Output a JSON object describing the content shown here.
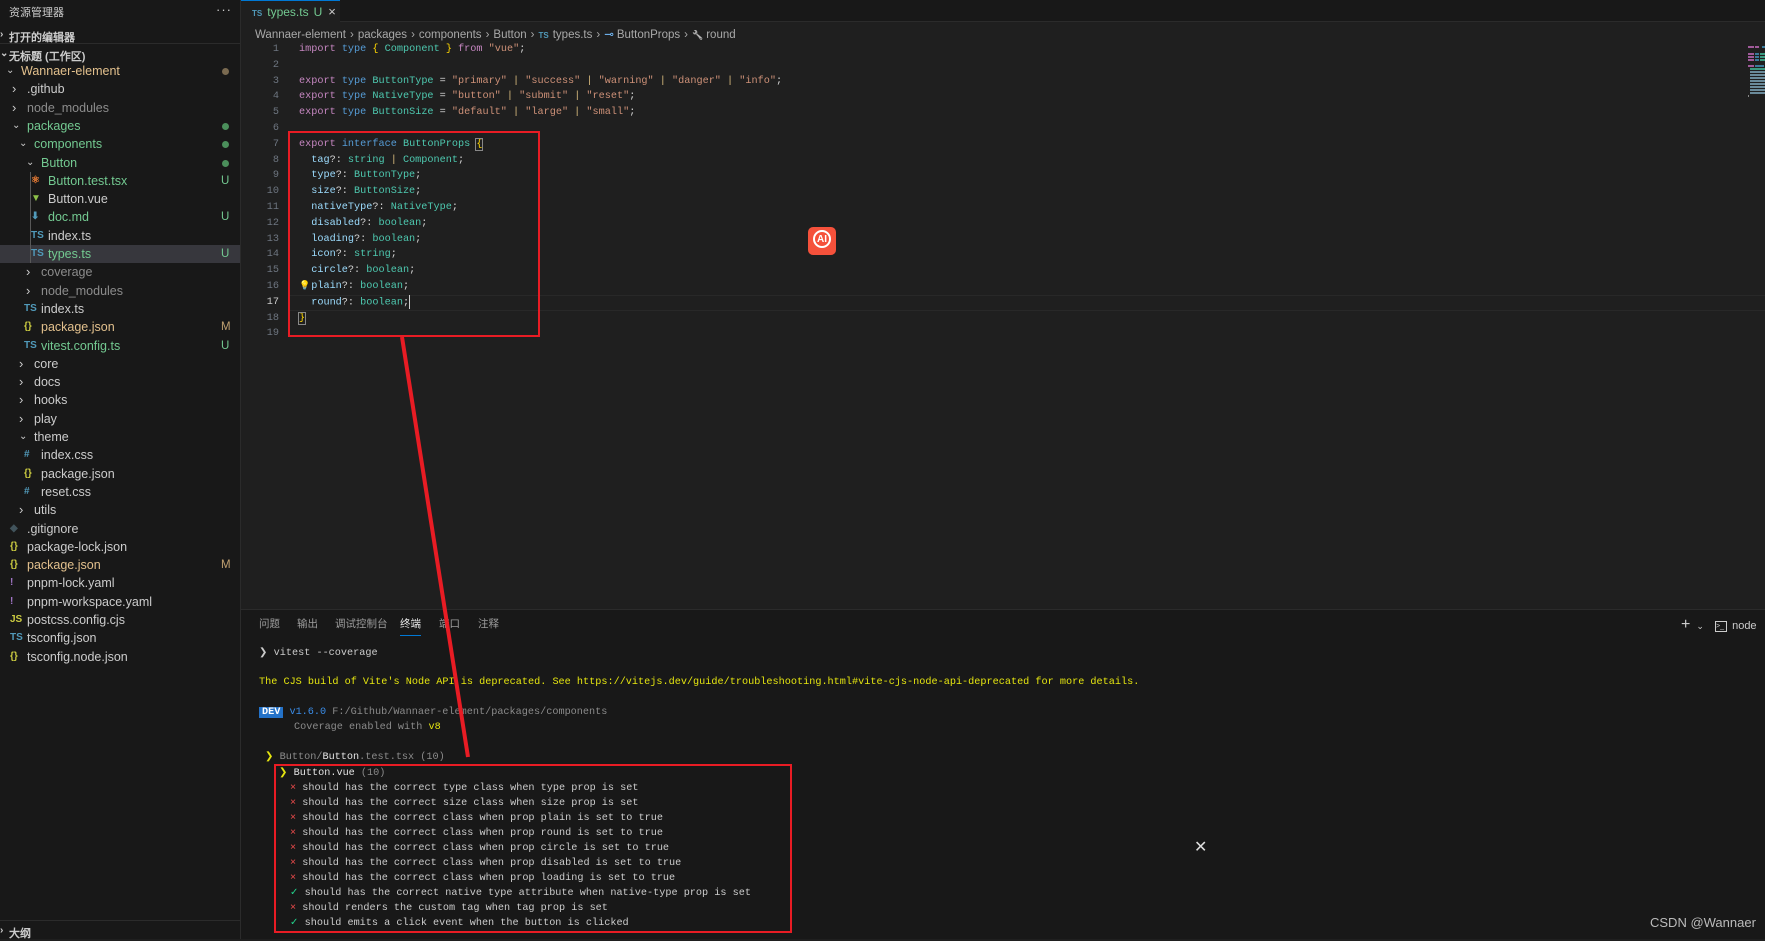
{
  "sidebar": {
    "title": "资源管理器",
    "more": "···",
    "open_editors": "打开的编辑器",
    "workspace": "无标题 (工作区)",
    "outline": "大纲",
    "items": [
      {
        "label": "Wannaer-element",
        "depth": 0,
        "kind": "open",
        "color": "#e2c08d",
        "dot": "#7a6a50"
      },
      {
        "label": ".github",
        "depth": 1,
        "kind": "closed",
        "color": "#cccccc"
      },
      {
        "label": "node_modules",
        "depth": 1,
        "kind": "closed",
        "color": "#8c8c8c"
      },
      {
        "label": "packages",
        "depth": 1,
        "kind": "open",
        "color": "#73c991",
        "dot": "#4b8f5b"
      },
      {
        "label": "components",
        "depth": 2,
        "kind": "open",
        "color": "#73c991",
        "dot": "#4b8f5b"
      },
      {
        "label": "Button",
        "depth": 3,
        "kind": "open",
        "color": "#73c991",
        "dot": "#4b8f5b"
      },
      {
        "label": "Button.test.tsx",
        "depth": 4,
        "kind": "file",
        "icon": "⚛",
        "icon_name": "react-icon",
        "icon_color": "#e37933",
        "color": "#73c991",
        "badge": "U",
        "badge_color": "#73c991"
      },
      {
        "label": "Button.vue",
        "depth": 4,
        "kind": "file",
        "icon": "▼",
        "icon_name": "vue-icon",
        "icon_color": "#8dc149",
        "color": "#cccccc"
      },
      {
        "label": "doc.md",
        "depth": 4,
        "kind": "file",
        "icon": "⬇",
        "icon_name": "markdown-icon",
        "icon_color": "#519aba",
        "color": "#73c991",
        "badge": "U",
        "badge_color": "#73c991"
      },
      {
        "label": "index.ts",
        "depth": 4,
        "kind": "file",
        "icon": "TS",
        "icon_name": "typescript-icon",
        "icon_color": "#519aba",
        "color": "#cccccc"
      },
      {
        "label": "types.ts",
        "depth": 4,
        "kind": "file",
        "icon": "TS",
        "icon_name": "typescript-icon",
        "icon_color": "#519aba",
        "color": "#73c991",
        "badge": "U",
        "badge_color": "#73c991",
        "selected": true
      },
      {
        "label": "coverage",
        "depth": 3,
        "kind": "closed",
        "color": "#8c8c8c"
      },
      {
        "label": "node_modules",
        "depth": 3,
        "kind": "closed",
        "color": "#8c8c8c"
      },
      {
        "label": "index.ts",
        "depth": 3,
        "kind": "file",
        "icon": "TS",
        "icon_name": "typescript-icon",
        "icon_color": "#519aba",
        "color": "#cccccc"
      },
      {
        "label": "package.json",
        "depth": 3,
        "kind": "file",
        "icon": "{}",
        "icon_name": "json-icon",
        "icon_color": "#cbcb41",
        "color": "#e2c08d",
        "badge": "M",
        "badge_color": "#c0a070"
      },
      {
        "label": "vitest.config.ts",
        "depth": 3,
        "kind": "file",
        "icon": "TS",
        "icon_name": "typescript-icon",
        "icon_color": "#519aba",
        "color": "#73c991",
        "badge": "U",
        "badge_color": "#73c991"
      },
      {
        "label": "core",
        "depth": 2,
        "kind": "closed",
        "color": "#cccccc"
      },
      {
        "label": "docs",
        "depth": 2,
        "kind": "closed",
        "color": "#cccccc"
      },
      {
        "label": "hooks",
        "depth": 2,
        "kind": "closed",
        "color": "#cccccc"
      },
      {
        "label": "play",
        "depth": 2,
        "kind": "closed",
        "color": "#cccccc"
      },
      {
        "label": "theme",
        "depth": 2,
        "kind": "open",
        "color": "#cccccc"
      },
      {
        "label": "index.css",
        "depth": 3,
        "kind": "file",
        "icon": "#",
        "icon_name": "css-icon",
        "icon_color": "#519aba",
        "color": "#cccccc"
      },
      {
        "label": "package.json",
        "depth": 3,
        "kind": "file",
        "icon": "{}",
        "icon_name": "json-icon",
        "icon_color": "#cbcb41",
        "color": "#cccccc"
      },
      {
        "label": "reset.css",
        "depth": 3,
        "kind": "file",
        "icon": "#",
        "icon_name": "css-icon",
        "icon_color": "#519aba",
        "color": "#cccccc"
      },
      {
        "label": "utils",
        "depth": 2,
        "kind": "closed",
        "color": "#cccccc"
      },
      {
        "label": ".gitignore",
        "depth": 1,
        "kind": "file",
        "icon": "◆",
        "icon_name": "git-icon",
        "icon_color": "#41535b",
        "color": "#cccccc"
      },
      {
        "label": "package-lock.json",
        "depth": 1,
        "kind": "file",
        "icon": "{}",
        "icon_name": "json-icon",
        "icon_color": "#cbcb41",
        "color": "#cccccc"
      },
      {
        "label": "package.json",
        "depth": 1,
        "kind": "file",
        "icon": "{}",
        "icon_name": "json-icon",
        "icon_color": "#cbcb41",
        "color": "#e2c08d",
        "badge": "M",
        "badge_color": "#c0a070"
      },
      {
        "label": "pnpm-lock.yaml",
        "depth": 1,
        "kind": "file",
        "icon": "!",
        "icon_name": "yaml-icon",
        "icon_color": "#a074c4",
        "color": "#cccccc"
      },
      {
        "label": "pnpm-workspace.yaml",
        "depth": 1,
        "kind": "file",
        "icon": "!",
        "icon_name": "yaml-icon",
        "icon_color": "#a074c4",
        "color": "#cccccc"
      },
      {
        "label": "postcss.config.cjs",
        "depth": 1,
        "kind": "file",
        "icon": "JS",
        "icon_name": "javascript-icon",
        "icon_color": "#cbcb41",
        "color": "#cccccc"
      },
      {
        "label": "tsconfig.json",
        "depth": 1,
        "kind": "file",
        "icon": "TS",
        "icon_name": "tsconfig-icon",
        "icon_color": "#519aba",
        "color": "#cccccc"
      },
      {
        "label": "tsconfig.node.json",
        "depth": 1,
        "kind": "file",
        "icon": "{}",
        "icon_name": "json-icon",
        "icon_color": "#cbcb41",
        "color": "#cccccc"
      }
    ]
  },
  "tab": {
    "icon": "TS",
    "name": "types.ts",
    "status": "U",
    "close": "×"
  },
  "breadcrumbs": [
    "Wannaer-element",
    "packages",
    "components",
    "Button",
    "types.ts",
    "ButtonProps",
    "round"
  ],
  "editor": {
    "current_line": 17,
    "lines": [
      [
        [
          "import",
          "k"
        ],
        [
          " ",
          "p"
        ],
        [
          "type",
          "b"
        ],
        [
          " ",
          "p"
        ],
        [
          "{",
          "y"
        ],
        [
          " ",
          "p"
        ],
        [
          "Component",
          "t"
        ],
        [
          " ",
          "p"
        ],
        [
          "}",
          "y"
        ],
        [
          " ",
          "p"
        ],
        [
          "from",
          "k"
        ],
        [
          " ",
          "p"
        ],
        [
          "\"vue\"",
          "s"
        ],
        [
          ";",
          "p"
        ]
      ],
      [],
      [
        [
          "export",
          "k"
        ],
        [
          " ",
          "p"
        ],
        [
          "type",
          "b"
        ],
        [
          " ",
          "p"
        ],
        [
          "ButtonType",
          "t"
        ],
        [
          " = ",
          "p"
        ],
        [
          "\"primary\"",
          "s"
        ],
        [
          " | ",
          "o"
        ],
        [
          "\"success\"",
          "s"
        ],
        [
          " | ",
          "o"
        ],
        [
          "\"warning\"",
          "s"
        ],
        [
          " | ",
          "o"
        ],
        [
          "\"danger\"",
          "s"
        ],
        [
          " | ",
          "o"
        ],
        [
          "\"info\"",
          "s"
        ],
        [
          ";",
          "p"
        ]
      ],
      [
        [
          "export",
          "k"
        ],
        [
          " ",
          "p"
        ],
        [
          "type",
          "b"
        ],
        [
          " ",
          "p"
        ],
        [
          "NativeType",
          "t"
        ],
        [
          " = ",
          "p"
        ],
        [
          "\"button\"",
          "s"
        ],
        [
          " | ",
          "o"
        ],
        [
          "\"submit\"",
          "s"
        ],
        [
          " | ",
          "o"
        ],
        [
          "\"reset\"",
          "s"
        ],
        [
          ";",
          "p"
        ]
      ],
      [
        [
          "export",
          "k"
        ],
        [
          " ",
          "p"
        ],
        [
          "type",
          "b"
        ],
        [
          " ",
          "p"
        ],
        [
          "ButtonSize",
          "t"
        ],
        [
          " = ",
          "p"
        ],
        [
          "\"default\"",
          "s"
        ],
        [
          " | ",
          "o"
        ],
        [
          "\"large\"",
          "s"
        ],
        [
          " | ",
          "o"
        ],
        [
          "\"small\"",
          "s"
        ],
        [
          ";",
          "p"
        ]
      ],
      [],
      [
        [
          "export",
          "k"
        ],
        [
          " ",
          "p"
        ],
        [
          "interface",
          "b"
        ],
        [
          " ",
          "p"
        ],
        [
          "ButtonProps",
          "t"
        ],
        [
          " ",
          "p"
        ],
        [
          "{",
          "y brace"
        ]
      ],
      [
        [
          "  tag",
          "v"
        ],
        [
          "?: ",
          "p"
        ],
        [
          "string",
          "t"
        ],
        [
          " | ",
          "o"
        ],
        [
          "Component",
          "t"
        ],
        [
          ";",
          "p"
        ]
      ],
      [
        [
          "  type",
          "v"
        ],
        [
          "?: ",
          "p"
        ],
        [
          "ButtonType",
          "t"
        ],
        [
          ";",
          "p"
        ]
      ],
      [
        [
          "  size",
          "v"
        ],
        [
          "?: ",
          "p"
        ],
        [
          "ButtonSize",
          "t"
        ],
        [
          ";",
          "p"
        ]
      ],
      [
        [
          "  nativeType",
          "v"
        ],
        [
          "?: ",
          "p"
        ],
        [
          "NativeType",
          "t"
        ],
        [
          ";",
          "p"
        ]
      ],
      [
        [
          "  disabled",
          "v"
        ],
        [
          "?: ",
          "p"
        ],
        [
          "boolean",
          "t"
        ],
        [
          ";",
          "p"
        ]
      ],
      [
        [
          "  loading",
          "v"
        ],
        [
          "?: ",
          "p"
        ],
        [
          "boolean",
          "t"
        ],
        [
          ";",
          "p"
        ]
      ],
      [
        [
          "  icon",
          "v"
        ],
        [
          "?: ",
          "p"
        ],
        [
          "string",
          "t"
        ],
        [
          ";",
          "p"
        ]
      ],
      [
        [
          "  circle",
          "v"
        ],
        [
          "?: ",
          "p"
        ],
        [
          "boolean",
          "t"
        ],
        [
          ";",
          "p"
        ]
      ],
      [
        [
          "  plain",
          "v"
        ],
        [
          "?: ",
          "p"
        ],
        [
          "boolean",
          "t"
        ],
        [
          ";",
          "p"
        ]
      ],
      [
        [
          "  round",
          "v"
        ],
        [
          "?: ",
          "p"
        ],
        [
          "boolean",
          "t"
        ],
        [
          ";",
          "p"
        ]
      ],
      [
        [
          "}",
          "y brace"
        ]
      ],
      []
    ]
  },
  "ai_badge": "AI",
  "panel": {
    "tabs": [
      "问题",
      "输出",
      "调试控制台",
      "终端",
      "端口",
      "注释"
    ],
    "active_tab": "终端",
    "shell": "node",
    "close": "✕",
    "command": "vitest --coverage",
    "warning": "The CJS build of Vite's Node API is deprecated. See https://vitejs.dev/guide/troubleshooting.html#vite-cjs-node-api-deprecated for more details.",
    "dev_badge": "DEV",
    "version": "v1.6.0",
    "path": "F:/Github/Wannaer-element/packages/components",
    "coverage_prefix": "Coverage enabled with",
    "coverage_provider": "v8",
    "file_prefix": "Button/",
    "file_name": "Button",
    "file_suffix": ".test.tsx (10)",
    "suite": "Button.vue",
    "suite_count": "(10)",
    "tests": [
      {
        "status": "fail",
        "name": "should has the correct type class when type prop is set"
      },
      {
        "status": "fail",
        "name": "should has the correct size class when size prop is set"
      },
      {
        "status": "fail",
        "name": "should has the correct class when prop plain is set to true"
      },
      {
        "status": "fail",
        "name": "should has the correct class when prop round is set to true"
      },
      {
        "status": "fail",
        "name": "should has the correct class when prop circle is set to true"
      },
      {
        "status": "fail",
        "name": "should has the correct class when prop disabled is set to true"
      },
      {
        "status": "fail",
        "name": "should has the correct class when prop loading is set to true"
      },
      {
        "status": "pass",
        "name": "should has the correct native type attribute when native-type prop is set"
      },
      {
        "status": "fail",
        "name": "should renders the custom tag when tag prop is set"
      },
      {
        "status": "pass",
        "name": "should emits a click event when the button is clicked"
      }
    ]
  },
  "watermark": "CSDN @Wannaer",
  "colors": {
    "annotation": "#e81c24",
    "accent": "#0078d4",
    "fail": "#f14c4c",
    "pass": "#23d18b"
  }
}
